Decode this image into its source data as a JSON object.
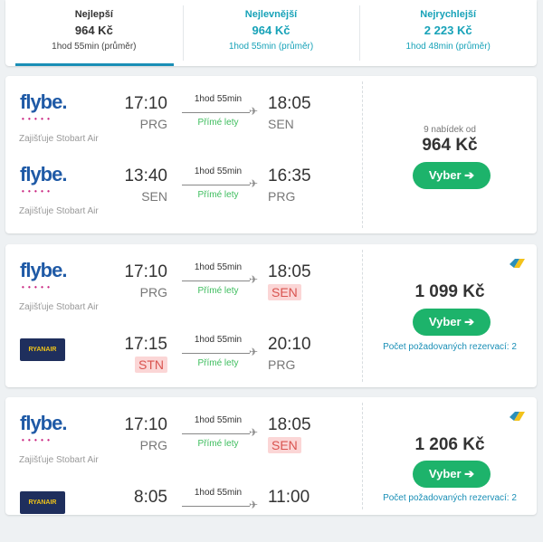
{
  "tabs": [
    {
      "label": "Nejlepší",
      "price": "964 Kč",
      "duration": "1hod 55min (průměr)"
    },
    {
      "label": "Nejlevnější",
      "price": "964 Kč",
      "duration": "1hod 55min (průměr)"
    },
    {
      "label": "Nejrychlejší",
      "price": "2 223 Kč",
      "duration": "1hod 48min (průměr)"
    }
  ],
  "results": [
    {
      "legs": [
        {
          "airline": "flybe.",
          "airline_dots": "• • • • •",
          "operator": "Zajišťuje Stobart Air",
          "dep_time": "17:10",
          "dep_airport": "PRG",
          "arr_time": "18:05",
          "arr_airport": "SEN",
          "duration": "1hod 55min",
          "stops": "Přímé lety"
        },
        {
          "airline": "flybe.",
          "airline_dots": "• • • • •",
          "operator": "Zajišťuje Stobart Air",
          "dep_time": "13:40",
          "dep_airport": "SEN",
          "arr_time": "16:35",
          "arr_airport": "PRG",
          "duration": "1hod 55min",
          "stops": "Přímé lety"
        }
      ],
      "offers": "9 nabídek od",
      "price": "964 Kč",
      "button": "Vyber ➔"
    },
    {
      "legs": [
        {
          "airline": "flybe.",
          "airline_dots": "• • • • •",
          "operator": "Zajišťuje Stobart Air",
          "dep_time": "17:10",
          "dep_airport": "PRG",
          "arr_time": "18:05",
          "arr_airport": "SEN",
          "duration": "1hod 55min",
          "stops": "Přímé lety"
        },
        {
          "airline": "RYANAIR",
          "dep_time": "17:15",
          "dep_airport": "STN",
          "arr_time": "20:10",
          "arr_airport": "PRG",
          "duration": "1hod 55min",
          "stops": "Přímé lety"
        }
      ],
      "price": "1 099 Kč",
      "button": "Vyber ➔",
      "note": "Počet požadovaných rezervací: 2"
    },
    {
      "legs": [
        {
          "airline": "flybe.",
          "airline_dots": "• • • • •",
          "operator": "Zajišťuje Stobart Air",
          "dep_time": "17:10",
          "dep_airport": "PRG",
          "arr_time": "18:05",
          "arr_airport": "SEN",
          "duration": "1hod 55min",
          "stops": "Přímé lety"
        },
        {
          "airline": "RYANAIR",
          "dep_time": "8:05",
          "arr_time": "11:00",
          "duration": "1hod 55min"
        }
      ],
      "price": "1 206 Kč",
      "button": "Vyber ➔",
      "note": "Počet požadovaných rezervací: 2"
    }
  ],
  "colors": {
    "accent": "#1a8fb6",
    "button": "#1db36b",
    "warning": "#d9534f",
    "direct": "#3dbd5d"
  }
}
